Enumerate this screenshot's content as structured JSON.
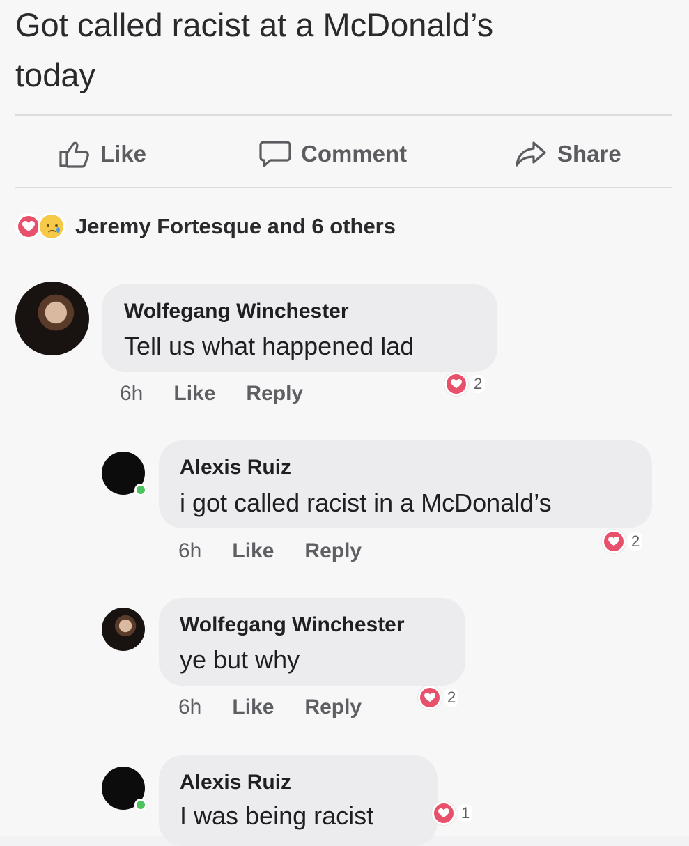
{
  "post": {
    "text_line1": "Got called racist at a McDonald’s",
    "text_line2": "today"
  },
  "actions": {
    "like_label": "Like",
    "comment_label": "Comment",
    "share_label": "Share"
  },
  "reactions": {
    "types": [
      "love",
      "sad"
    ],
    "summary": "Jeremy Fortesque and 6 others"
  },
  "comments": [
    {
      "author": "Wolfegang Winchester",
      "text": "Tell us what happened lad",
      "time": "6h",
      "like_label": "Like",
      "reply_label": "Reply",
      "reaction_count": "2"
    },
    {
      "author": "Alexis Ruiz",
      "text": "i got called racist in a McDonald’s",
      "time": "6h",
      "like_label": "Like",
      "reply_label": "Reply",
      "reaction_count": "2"
    },
    {
      "author": "Wolfegang Winchester",
      "text": "ye but why",
      "time": "6h",
      "like_label": "Like",
      "reply_label": "Reply",
      "reaction_count": "2"
    },
    {
      "author": "Alexis Ruiz",
      "text": "I was being racist",
      "reaction_count": "1"
    }
  ],
  "colors": {
    "love": "#e8516b",
    "sad": "#f7c948",
    "online": "#4cc45e",
    "bubble": "#ececee"
  }
}
